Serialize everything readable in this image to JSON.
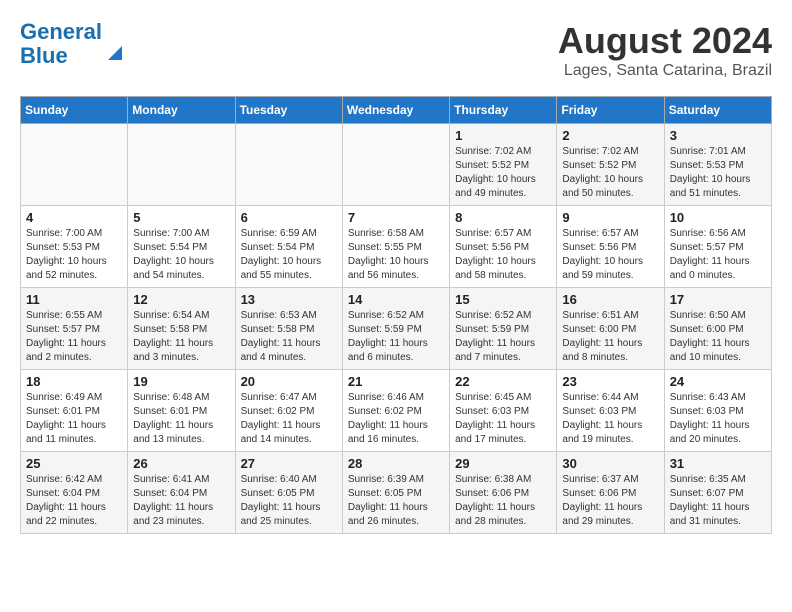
{
  "header": {
    "logo_line1": "General",
    "logo_line2": "Blue",
    "month_year": "August 2024",
    "location": "Lages, Santa Catarina, Brazil"
  },
  "weekdays": [
    "Sunday",
    "Monday",
    "Tuesday",
    "Wednesday",
    "Thursday",
    "Friday",
    "Saturday"
  ],
  "weeks": [
    [
      {
        "day": "",
        "detail": ""
      },
      {
        "day": "",
        "detail": ""
      },
      {
        "day": "",
        "detail": ""
      },
      {
        "day": "",
        "detail": ""
      },
      {
        "day": "1",
        "detail": "Sunrise: 7:02 AM\nSunset: 5:52 PM\nDaylight: 10 hours\nand 49 minutes."
      },
      {
        "day": "2",
        "detail": "Sunrise: 7:02 AM\nSunset: 5:52 PM\nDaylight: 10 hours\nand 50 minutes."
      },
      {
        "day": "3",
        "detail": "Sunrise: 7:01 AM\nSunset: 5:53 PM\nDaylight: 10 hours\nand 51 minutes."
      }
    ],
    [
      {
        "day": "4",
        "detail": "Sunrise: 7:00 AM\nSunset: 5:53 PM\nDaylight: 10 hours\nand 52 minutes."
      },
      {
        "day": "5",
        "detail": "Sunrise: 7:00 AM\nSunset: 5:54 PM\nDaylight: 10 hours\nand 54 minutes."
      },
      {
        "day": "6",
        "detail": "Sunrise: 6:59 AM\nSunset: 5:54 PM\nDaylight: 10 hours\nand 55 minutes."
      },
      {
        "day": "7",
        "detail": "Sunrise: 6:58 AM\nSunset: 5:55 PM\nDaylight: 10 hours\nand 56 minutes."
      },
      {
        "day": "8",
        "detail": "Sunrise: 6:57 AM\nSunset: 5:56 PM\nDaylight: 10 hours\nand 58 minutes."
      },
      {
        "day": "9",
        "detail": "Sunrise: 6:57 AM\nSunset: 5:56 PM\nDaylight: 10 hours\nand 59 minutes."
      },
      {
        "day": "10",
        "detail": "Sunrise: 6:56 AM\nSunset: 5:57 PM\nDaylight: 11 hours\nand 0 minutes."
      }
    ],
    [
      {
        "day": "11",
        "detail": "Sunrise: 6:55 AM\nSunset: 5:57 PM\nDaylight: 11 hours\nand 2 minutes."
      },
      {
        "day": "12",
        "detail": "Sunrise: 6:54 AM\nSunset: 5:58 PM\nDaylight: 11 hours\nand 3 minutes."
      },
      {
        "day": "13",
        "detail": "Sunrise: 6:53 AM\nSunset: 5:58 PM\nDaylight: 11 hours\nand 4 minutes."
      },
      {
        "day": "14",
        "detail": "Sunrise: 6:52 AM\nSunset: 5:59 PM\nDaylight: 11 hours\nand 6 minutes."
      },
      {
        "day": "15",
        "detail": "Sunrise: 6:52 AM\nSunset: 5:59 PM\nDaylight: 11 hours\nand 7 minutes."
      },
      {
        "day": "16",
        "detail": "Sunrise: 6:51 AM\nSunset: 6:00 PM\nDaylight: 11 hours\nand 8 minutes."
      },
      {
        "day": "17",
        "detail": "Sunrise: 6:50 AM\nSunset: 6:00 PM\nDaylight: 11 hours\nand 10 minutes."
      }
    ],
    [
      {
        "day": "18",
        "detail": "Sunrise: 6:49 AM\nSunset: 6:01 PM\nDaylight: 11 hours\nand 11 minutes."
      },
      {
        "day": "19",
        "detail": "Sunrise: 6:48 AM\nSunset: 6:01 PM\nDaylight: 11 hours\nand 13 minutes."
      },
      {
        "day": "20",
        "detail": "Sunrise: 6:47 AM\nSunset: 6:02 PM\nDaylight: 11 hours\nand 14 minutes."
      },
      {
        "day": "21",
        "detail": "Sunrise: 6:46 AM\nSunset: 6:02 PM\nDaylight: 11 hours\nand 16 minutes."
      },
      {
        "day": "22",
        "detail": "Sunrise: 6:45 AM\nSunset: 6:03 PM\nDaylight: 11 hours\nand 17 minutes."
      },
      {
        "day": "23",
        "detail": "Sunrise: 6:44 AM\nSunset: 6:03 PM\nDaylight: 11 hours\nand 19 minutes."
      },
      {
        "day": "24",
        "detail": "Sunrise: 6:43 AM\nSunset: 6:03 PM\nDaylight: 11 hours\nand 20 minutes."
      }
    ],
    [
      {
        "day": "25",
        "detail": "Sunrise: 6:42 AM\nSunset: 6:04 PM\nDaylight: 11 hours\nand 22 minutes."
      },
      {
        "day": "26",
        "detail": "Sunrise: 6:41 AM\nSunset: 6:04 PM\nDaylight: 11 hours\nand 23 minutes."
      },
      {
        "day": "27",
        "detail": "Sunrise: 6:40 AM\nSunset: 6:05 PM\nDaylight: 11 hours\nand 25 minutes."
      },
      {
        "day": "28",
        "detail": "Sunrise: 6:39 AM\nSunset: 6:05 PM\nDaylight: 11 hours\nand 26 minutes."
      },
      {
        "day": "29",
        "detail": "Sunrise: 6:38 AM\nSunset: 6:06 PM\nDaylight: 11 hours\nand 28 minutes."
      },
      {
        "day": "30",
        "detail": "Sunrise: 6:37 AM\nSunset: 6:06 PM\nDaylight: 11 hours\nand 29 minutes."
      },
      {
        "day": "31",
        "detail": "Sunrise: 6:35 AM\nSunset: 6:07 PM\nDaylight: 11 hours\nand 31 minutes."
      }
    ]
  ]
}
